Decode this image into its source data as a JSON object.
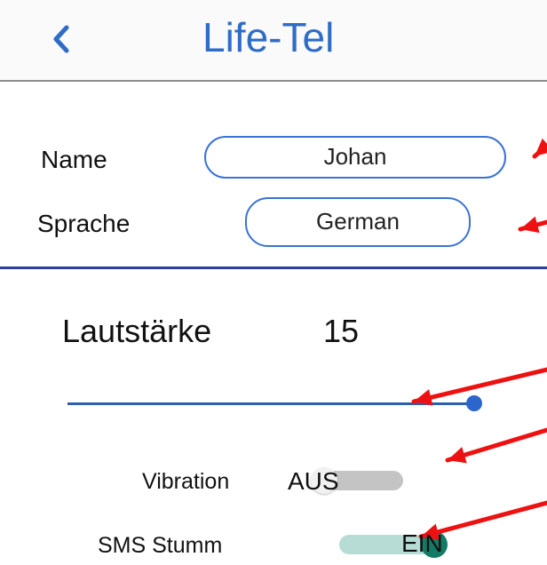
{
  "header": {
    "back_icon": "chevron-left-icon",
    "title": "Life-Tel"
  },
  "form": {
    "name_label": "Name",
    "name_value": "Johan",
    "language_label": "Sprache",
    "language_value": "German"
  },
  "volume": {
    "label": "Lautstärke",
    "value": "15",
    "level": 1.0
  },
  "toggles": {
    "vibration": {
      "label": "Vibration",
      "state_text": "AUS",
      "on": false
    },
    "sms_mute": {
      "label": "SMS Stumm",
      "state_text": "EIN",
      "on": true
    }
  },
  "colors": {
    "accent": "#2f6cc6",
    "divider": "#2b3f9a",
    "annotation_arrow": "#ee1111",
    "toggle_on_thumb": "#147a66",
    "toggle_on_track": "#b7dcd5",
    "toggle_off_track": "#c4c4c4",
    "toggle_off_thumb": "#f1f1f1"
  }
}
